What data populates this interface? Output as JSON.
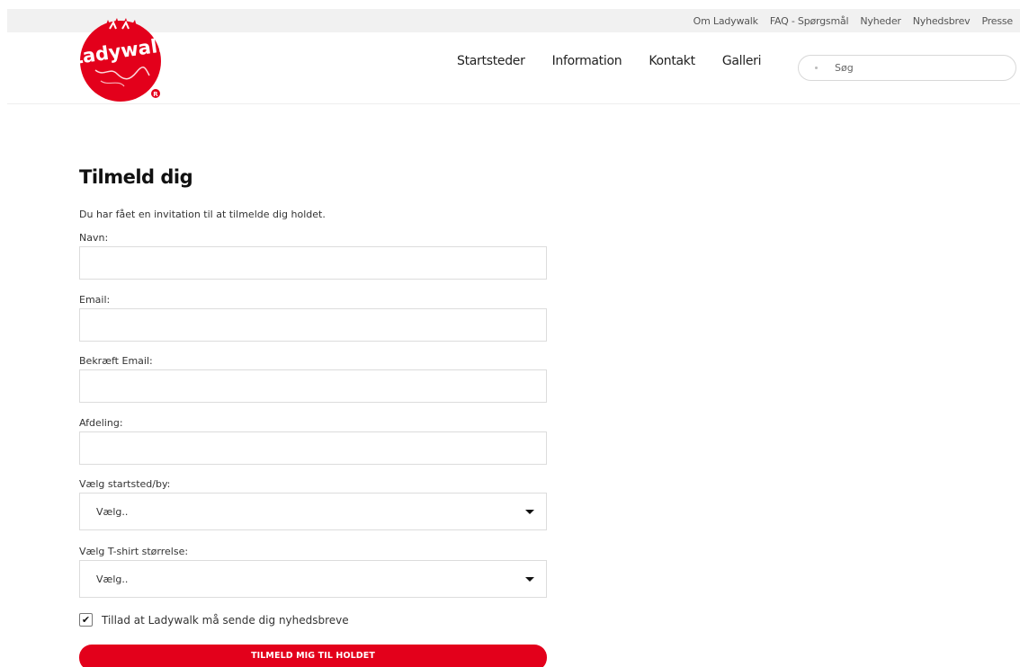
{
  "brand": {
    "name": "Ladywalk",
    "logo_color": "#e3001b"
  },
  "top_nav": {
    "links": [
      "Om Ladywalk",
      "FAQ - Spørgsmål",
      "Nyheder",
      "Nyhedsbrev",
      "Presse"
    ]
  },
  "main_nav": {
    "links": [
      "Startsteder",
      "Information",
      "Kontakt",
      "Galleri"
    ]
  },
  "search": {
    "placeholder": "Søg",
    "icon": "search-icon"
  },
  "form": {
    "title": "Tilmeld dig",
    "intro": "Du har fået en invitation til at tilmelde dig holdet.",
    "fields": {
      "navn": {
        "label": "Navn:",
        "value": ""
      },
      "email": {
        "label": "Email:",
        "value": ""
      },
      "confirm_email": {
        "label": "Bekræft Email:",
        "value": ""
      },
      "afdeling": {
        "label": "Afdeling:",
        "value": ""
      }
    },
    "selects": {
      "startsted": {
        "label": "Vælg startsted/by:",
        "value": "Vælg.."
      },
      "tshirt": {
        "label": "Vælg T-shirt størrelse:",
        "value": "Vælg.."
      }
    },
    "newsletter": {
      "label": "Tillad at Ladywalk må sende dig nyhedsbreve",
      "checked": true
    },
    "submit_label": "TILMELD MIG TIL HOLDET"
  },
  "colors": {
    "accent": "#e3001b",
    "topbar": "#f1f1f1"
  }
}
